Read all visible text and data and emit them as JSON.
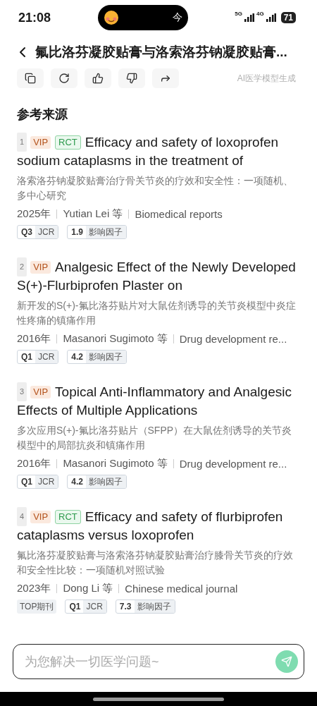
{
  "status_bar": {
    "time": "21:08",
    "island_text": "今",
    "network_1": "5G",
    "network_2": "4G",
    "battery": "71"
  },
  "header": {
    "title": "氟比洛芬凝胶贴膏与洛索洛芬钠凝胶贴膏..."
  },
  "actions": {
    "buttons": [
      {
        "kind": "copy"
      },
      {
        "kind": "refresh"
      },
      {
        "kind": "like"
      },
      {
        "kind": "dislike"
      },
      {
        "kind": "share"
      }
    ],
    "note": "AI医学模型生成"
  },
  "section_title": "参考来源",
  "references": [
    {
      "index": "1",
      "badges": [
        {
          "kind": "vip",
          "label": "VIP"
        },
        {
          "kind": "rct",
          "label": "RCT"
        }
      ],
      "title": "Efficacy and safety of loxoprofen sodium cataplasms in the treatment of",
      "summary": "洛索洛芬钠凝胶贴膏治疗骨关节炎的疗效和安全性：一项随机、多中心研究",
      "year": "2025年",
      "authors": "Yutian Lei 等",
      "journal": "Biomedical reports",
      "metrics": [
        {
          "kind": "pair",
          "value": "Q3",
          "label": "JCR"
        },
        {
          "kind": "pair",
          "value": "1.9",
          "label": "影响因子"
        }
      ]
    },
    {
      "index": "2",
      "badges": [
        {
          "kind": "vip",
          "label": "VIP"
        }
      ],
      "title": "Analgesic Effect of the Newly Developed S(+)-Flurbiprofen Plaster on",
      "summary": "新开发的S(+)-氟比洛芬贴片对大鼠佐剂诱导的关节炎模型中炎症性疼痛的镇痛作用",
      "year": "2016年",
      "authors": "Masanori Sugimoto 等",
      "journal": "Drug development re...",
      "metrics": [
        {
          "kind": "pair",
          "value": "Q1",
          "label": "JCR"
        },
        {
          "kind": "pair",
          "value": "4.2",
          "label": "影响因子"
        }
      ]
    },
    {
      "index": "3",
      "badges": [
        {
          "kind": "vip",
          "label": "VIP"
        }
      ],
      "title": "Topical Anti-Inflammatory and Analgesic Effects of Multiple Applications",
      "summary": "多次应用S(+)-氟比洛芬贴片（SFPP）在大鼠佐剂诱导的关节炎模型中的局部抗炎和镇痛作用",
      "year": "2016年",
      "authors": "Masanori Sugimoto 等",
      "journal": "Drug development re...",
      "metrics": [
        {
          "kind": "pair",
          "value": "Q1",
          "label": "JCR"
        },
        {
          "kind": "pair",
          "value": "4.2",
          "label": "影响因子"
        }
      ]
    },
    {
      "index": "4",
      "badges": [
        {
          "kind": "vip",
          "label": "VIP"
        },
        {
          "kind": "rct",
          "label": "RCT"
        }
      ],
      "title": "Efficacy and safety of flurbiprofen cataplasms versus loxoprofen",
      "summary": "氟比洛芬凝胶贴膏与洛索洛芬钠凝胶贴膏治疗膝骨关节炎的疗效和安全性比较：一项随机对照试验",
      "year": "2023年",
      "authors": "Dong Li 等",
      "journal": "Chinese medical journal",
      "metrics": [
        {
          "kind": "single",
          "label": "TOP期刊"
        },
        {
          "kind": "pair",
          "value": "Q1",
          "label": "JCR"
        },
        {
          "kind": "pair",
          "value": "7.3",
          "label": "影响因子"
        }
      ]
    }
  ],
  "input": {
    "placeholder": "为您解决一切医学问题~"
  }
}
